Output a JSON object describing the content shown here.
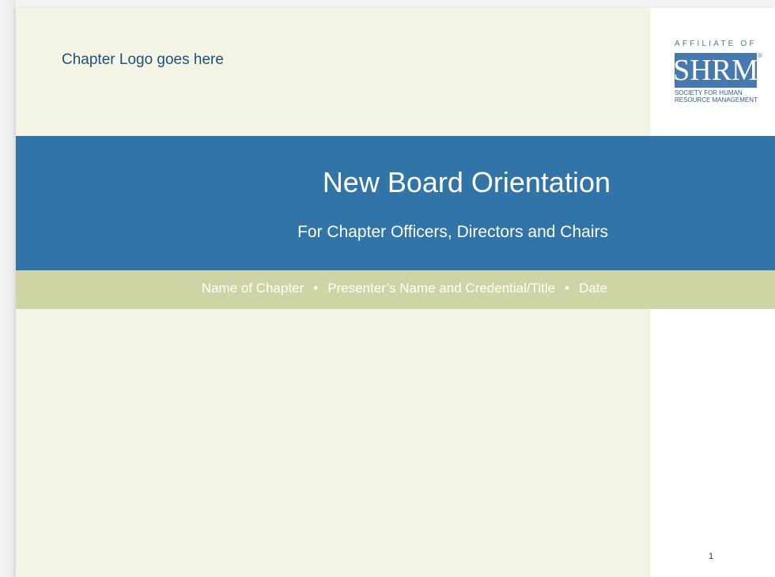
{
  "slide": {
    "logo_placeholder": "Chapter Logo goes here",
    "title": "New Board Orientation",
    "subtitle": "For Chapter Officers, Directors and Chairs",
    "info": {
      "chapter": "Name of Chapter",
      "presenter": "Presenter’s Name and Credential/Title",
      "date": "Date",
      "separator": "•"
    },
    "page_number": "1"
  },
  "shrm_logo": {
    "affiliate": "AFFILIATE OF",
    "wordmark": "SHRM",
    "registered": "®",
    "tagline_1": "SOCIETY FOR HUMAN",
    "tagline_2": "RESOURCE MANAGEMENT"
  },
  "colors": {
    "cream": "#f3f4e3",
    "title_band": "#3175a8",
    "info_band": "#cfd4a4",
    "shrm_blue": "#4679b0",
    "logo_text": "#1f4f7c"
  }
}
